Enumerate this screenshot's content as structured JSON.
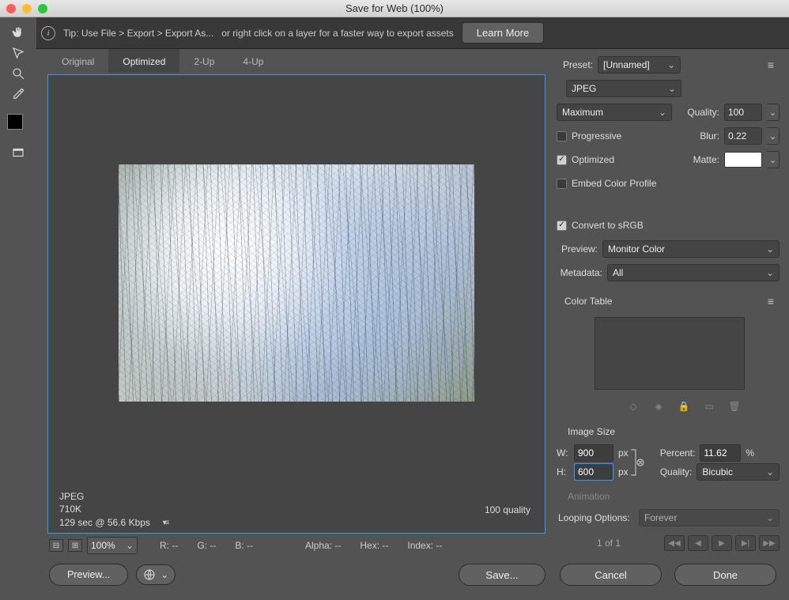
{
  "window": {
    "title": "Save for Web (100%)"
  },
  "tip": {
    "prefix": "Tip: Use File > Export > Export As...",
    "suffix": "or right click on a layer for a faster way to export assets",
    "learn_more": "Learn More"
  },
  "tabs": {
    "original": "Original",
    "optimized": "Optimized",
    "two_up": "2-Up",
    "four_up": "4-Up"
  },
  "canvas": {
    "format": "JPEG",
    "size": "710K",
    "timing": "129 sec @ 56.6 Kbps",
    "quality_readout": "100 quality"
  },
  "readout": {
    "zoom": "100%",
    "r": "R: --",
    "g": "G: --",
    "b": "B: --",
    "alpha": "Alpha: --",
    "hex": "Hex: --",
    "index": "Index: --"
  },
  "buttons": {
    "preview": "Preview...",
    "save": "Save...",
    "cancel": "Cancel",
    "done": "Done"
  },
  "preset": {
    "label": "Preset:",
    "value": "[Unnamed]"
  },
  "format": {
    "value": "JPEG"
  },
  "compression": {
    "value": "Maximum",
    "quality_label": "Quality:",
    "quality_value": "100"
  },
  "options": {
    "progressive": "Progressive",
    "blur_label": "Blur:",
    "blur_value": "0.22",
    "optimized": "Optimized",
    "matte_label": "Matte:",
    "embed_profile": "Embed Color Profile"
  },
  "color": {
    "convert_srgb": "Convert to sRGB",
    "preview_label": "Preview:",
    "preview_value": "Monitor Color",
    "metadata_label": "Metadata:",
    "metadata_value": "All",
    "table_title": "Color Table"
  },
  "image_size": {
    "title": "Image Size",
    "w_label": "W:",
    "w_value": "900",
    "h_label": "H:",
    "h_value": "600",
    "px": "px",
    "percent_label": "Percent:",
    "percent_value": "11.62",
    "percent_suffix": "%",
    "quality_label": "Quality:",
    "quality_value": "Bicubic"
  },
  "animation": {
    "title": "Animation",
    "looping_label": "Looping Options:",
    "looping_value": "Forever",
    "pager": "1 of 1"
  }
}
